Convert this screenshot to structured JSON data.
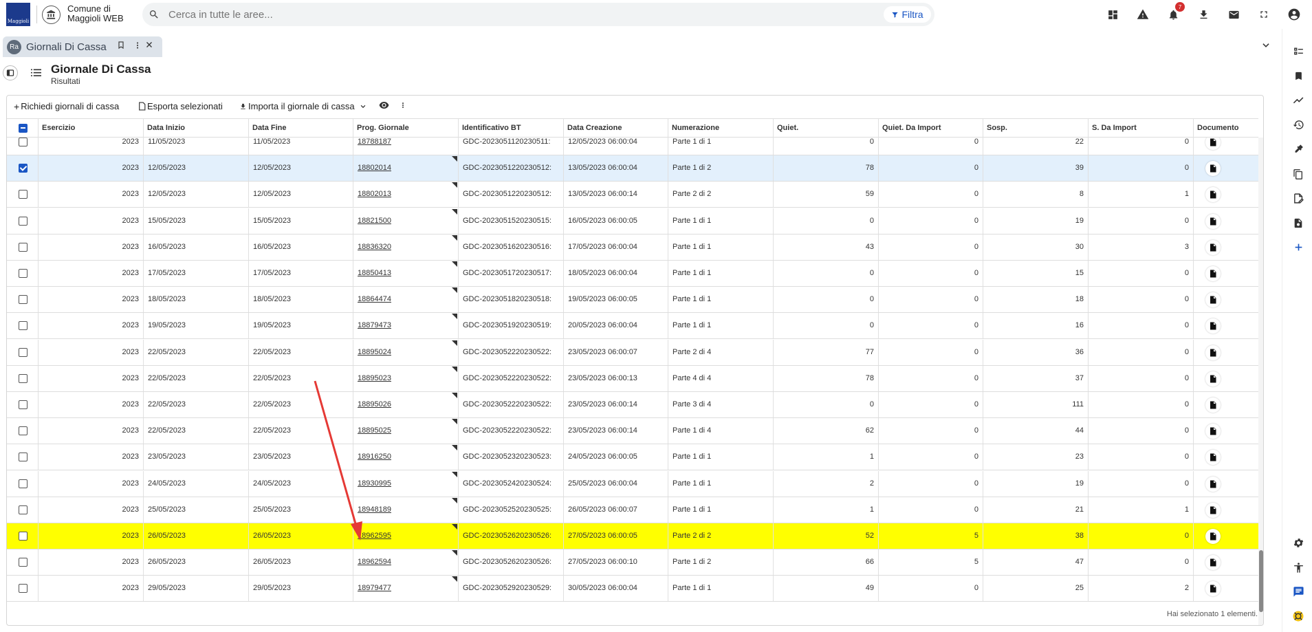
{
  "app": {
    "name_line1": "Comune di",
    "name_line2": "Maggioli WEB",
    "logo_text": "Maggioli"
  },
  "search": {
    "placeholder": "Cerca in tutte le aree...",
    "filter_label": "Filtra"
  },
  "notifications": {
    "count": "7"
  },
  "tab": {
    "label": "Giornali Di Cassa",
    "icon_text": "Ra"
  },
  "page": {
    "title": "Giornale Di Cassa",
    "subtitle": "Risultati"
  },
  "toolbar": {
    "request_label": "Richiedi giornali di cassa",
    "export_label": "Esporta selezionati",
    "import_label": "Importa il giornale di cassa"
  },
  "columns": [
    "Esercizio",
    "Data Inizio",
    "Data Fine",
    "Prog. Giornale",
    "Identificativo BT",
    "Data Creazione",
    "Numerazione",
    "Quiet.",
    "Quiet. Da Import",
    "Sosp.",
    "S. Da Import",
    "Documento"
  ],
  "rows": [
    {
      "esercizio": "2023",
      "inizio": "11/05/2023",
      "fine": "11/05/2023",
      "prog": "18788187",
      "bt": "GDC-2023051120230511:",
      "creazione": "12/05/2023 06:00:04",
      "num": "Parte 1 di 1",
      "quiet": "0",
      "qimp": "0",
      "sosp": "22",
      "simp": "0",
      "checked": false,
      "highlight": false
    },
    {
      "esercizio": "2023",
      "inizio": "12/05/2023",
      "fine": "12/05/2023",
      "prog": "18802014",
      "bt": "GDC-2023051220230512:",
      "creazione": "13/05/2023 06:00:04",
      "num": "Parte 1 di 2",
      "quiet": "78",
      "qimp": "0",
      "sosp": "39",
      "simp": "0",
      "checked": true,
      "highlight": false
    },
    {
      "esercizio": "2023",
      "inizio": "12/05/2023",
      "fine": "12/05/2023",
      "prog": "18802013",
      "bt": "GDC-2023051220230512:",
      "creazione": "13/05/2023 06:00:14",
      "num": "Parte 2 di 2",
      "quiet": "59",
      "qimp": "0",
      "sosp": "8",
      "simp": "1",
      "checked": false,
      "highlight": false
    },
    {
      "esercizio": "2023",
      "inizio": "15/05/2023",
      "fine": "15/05/2023",
      "prog": "18821500",
      "bt": "GDC-2023051520230515:",
      "creazione": "16/05/2023 06:00:05",
      "num": "Parte 1 di 1",
      "quiet": "0",
      "qimp": "0",
      "sosp": "19",
      "simp": "0",
      "checked": false,
      "highlight": false
    },
    {
      "esercizio": "2023",
      "inizio": "16/05/2023",
      "fine": "16/05/2023",
      "prog": "18836320",
      "bt": "GDC-2023051620230516:",
      "creazione": "17/05/2023 06:00:04",
      "num": "Parte 1 di 1",
      "quiet": "43",
      "qimp": "0",
      "sosp": "30",
      "simp": "3",
      "checked": false,
      "highlight": false
    },
    {
      "esercizio": "2023",
      "inizio": "17/05/2023",
      "fine": "17/05/2023",
      "prog": "18850413",
      "bt": "GDC-2023051720230517:",
      "creazione": "18/05/2023 06:00:04",
      "num": "Parte 1 di 1",
      "quiet": "0",
      "qimp": "0",
      "sosp": "15",
      "simp": "0",
      "checked": false,
      "highlight": false
    },
    {
      "esercizio": "2023",
      "inizio": "18/05/2023",
      "fine": "18/05/2023",
      "prog": "18864474",
      "bt": "GDC-2023051820230518:",
      "creazione": "19/05/2023 06:00:05",
      "num": "Parte 1 di 1",
      "quiet": "0",
      "qimp": "0",
      "sosp": "18",
      "simp": "0",
      "checked": false,
      "highlight": false
    },
    {
      "esercizio": "2023",
      "inizio": "19/05/2023",
      "fine": "19/05/2023",
      "prog": "18879473",
      "bt": "GDC-2023051920230519:",
      "creazione": "20/05/2023 06:00:04",
      "num": "Parte 1 di 1",
      "quiet": "0",
      "qimp": "0",
      "sosp": "16",
      "simp": "0",
      "checked": false,
      "highlight": false
    },
    {
      "esercizio": "2023",
      "inizio": "22/05/2023",
      "fine": "22/05/2023",
      "prog": "18895024",
      "bt": "GDC-2023052220230522:",
      "creazione": "23/05/2023 06:00:07",
      "num": "Parte 2 di 4",
      "quiet": "77",
      "qimp": "0",
      "sosp": "36",
      "simp": "0",
      "checked": false,
      "highlight": false
    },
    {
      "esercizio": "2023",
      "inizio": "22/05/2023",
      "fine": "22/05/2023",
      "prog": "18895023",
      "bt": "GDC-2023052220230522:",
      "creazione": "23/05/2023 06:00:13",
      "num": "Parte 4 di 4",
      "quiet": "78",
      "qimp": "0",
      "sosp": "37",
      "simp": "0",
      "checked": false,
      "highlight": false
    },
    {
      "esercizio": "2023",
      "inizio": "22/05/2023",
      "fine": "22/05/2023",
      "prog": "18895026",
      "bt": "GDC-2023052220230522:",
      "creazione": "23/05/2023 06:00:14",
      "num": "Parte 3 di 4",
      "quiet": "0",
      "qimp": "0",
      "sosp": "111",
      "simp": "0",
      "checked": false,
      "highlight": false
    },
    {
      "esercizio": "2023",
      "inizio": "22/05/2023",
      "fine": "22/05/2023",
      "prog": "18895025",
      "bt": "GDC-2023052220230522:",
      "creazione": "23/05/2023 06:00:14",
      "num": "Parte 1 di 4",
      "quiet": "62",
      "qimp": "0",
      "sosp": "44",
      "simp": "0",
      "checked": false,
      "highlight": false
    },
    {
      "esercizio": "2023",
      "inizio": "23/05/2023",
      "fine": "23/05/2023",
      "prog": "18916250",
      "bt": "GDC-2023052320230523:",
      "creazione": "24/05/2023 06:00:05",
      "num": "Parte 1 di 1",
      "quiet": "1",
      "qimp": "0",
      "sosp": "23",
      "simp": "0",
      "checked": false,
      "highlight": false
    },
    {
      "esercizio": "2023",
      "inizio": "24/05/2023",
      "fine": "24/05/2023",
      "prog": "18930995",
      "bt": "GDC-2023052420230524:",
      "creazione": "25/05/2023 06:00:04",
      "num": "Parte 1 di 1",
      "quiet": "2",
      "qimp": "0",
      "sosp": "19",
      "simp": "0",
      "checked": false,
      "highlight": false
    },
    {
      "esercizio": "2023",
      "inizio": "25/05/2023",
      "fine": "25/05/2023",
      "prog": "18948189",
      "bt": "GDC-2023052520230525:",
      "creazione": "26/05/2023 06:00:07",
      "num": "Parte 1 di 1",
      "quiet": "1",
      "qimp": "0",
      "sosp": "21",
      "simp": "1",
      "checked": false,
      "highlight": false
    },
    {
      "esercizio": "2023",
      "inizio": "26/05/2023",
      "fine": "26/05/2023",
      "prog": "18962595",
      "bt": "GDC-2023052620230526:",
      "creazione": "27/05/2023 06:00:05",
      "num": "Parte 2 di 2",
      "quiet": "52",
      "qimp": "5",
      "sosp": "38",
      "simp": "0",
      "checked": false,
      "highlight": true
    },
    {
      "esercizio": "2023",
      "inizio": "26/05/2023",
      "fine": "26/05/2023",
      "prog": "18962594",
      "bt": "GDC-2023052620230526:",
      "creazione": "27/05/2023 06:00:10",
      "num": "Parte 1 di 2",
      "quiet": "66",
      "qimp": "5",
      "sosp": "47",
      "simp": "0",
      "checked": false,
      "highlight": false
    },
    {
      "esercizio": "2023",
      "inizio": "29/05/2023",
      "fine": "29/05/2023",
      "prog": "18979477",
      "bt": "GDC-2023052920230529:",
      "creazione": "30/05/2023 06:00:04",
      "num": "Parte 1 di 1",
      "quiet": "49",
      "qimp": "0",
      "sosp": "25",
      "simp": "2",
      "checked": false,
      "highlight": false
    }
  ],
  "footer": {
    "selection_text": "Hai selezionato 1 elementi."
  },
  "colors": {
    "accent": "#1a56c4",
    "highlight": "#ffff00",
    "selected_row": "#e3f0fc",
    "annotation_arrow": "#e53935"
  },
  "icons": {
    "top": [
      "dashboard-icon",
      "warning-icon",
      "bell-icon",
      "download-icon",
      "mail-icon",
      "fullscreen-icon",
      "user-icon"
    ],
    "rail": [
      "checklist-icon",
      "bookmark-icon",
      "trending-icon",
      "history-icon",
      "plugin-icon",
      "copy-icon",
      "file-sign-icon",
      "file-settings-icon",
      "plus-icon",
      "settings-icon",
      "accessibility-icon",
      "chat-icon",
      "help-icon"
    ]
  }
}
